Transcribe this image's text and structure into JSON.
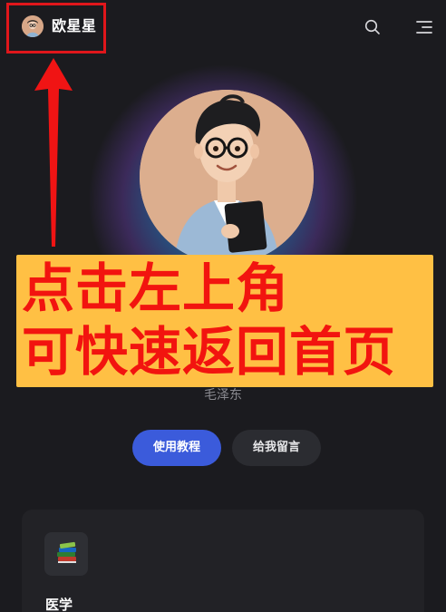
{
  "header": {
    "brand_title": "欧星星",
    "search_icon": "search-icon",
    "menu_icon": "menu-icon"
  },
  "hero": {
    "subtitle": "毛泽东"
  },
  "annotation": {
    "line1": "点击左上角",
    "line2": "可快速返回首页",
    "banner_color": "#ffc044",
    "text_color": "#f2140f",
    "highlight_color": "#e0161b"
  },
  "actions": {
    "primary_label": "使用教程",
    "secondary_label": "给我留言",
    "primary_color": "#3b5bdb"
  },
  "card": {
    "icon": "books-icon",
    "title": "医学"
  }
}
